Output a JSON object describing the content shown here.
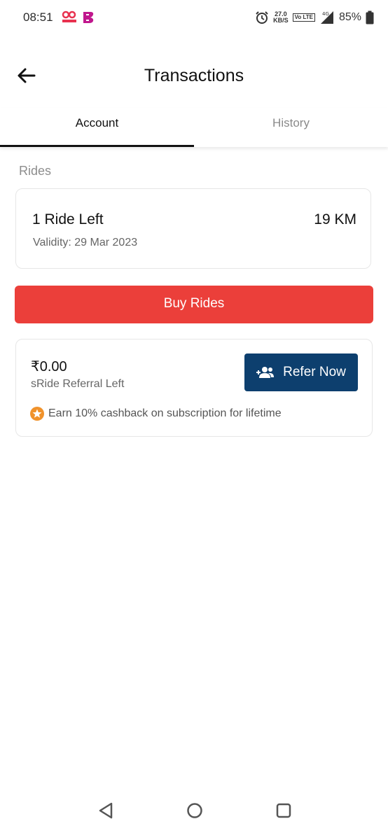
{
  "status_bar": {
    "time": "08:51",
    "speed_value": "27.0",
    "speed_unit": "KB/S",
    "volte": "Vo LTE",
    "network": "4G",
    "battery": "85%"
  },
  "header": {
    "title": "Transactions",
    "back_icon": "arrow-left-icon"
  },
  "tabs": [
    {
      "label": "Account",
      "active": true
    },
    {
      "label": "History",
      "active": false
    }
  ],
  "rides_section": {
    "label": "Rides",
    "rides_left": "1 Ride Left",
    "distance": "19 KM",
    "validity": "Validity: 29 Mar 2023"
  },
  "buy_button": {
    "label": "Buy Rides",
    "color": "#eb3f3a"
  },
  "referral": {
    "amount": "₹0.00",
    "label": "sRide Referral Left",
    "button_label": "Refer Now",
    "button_color": "#0d3f6e",
    "cashback_text": "Earn 10% cashback on subscription for lifetime",
    "cashback_icon": "star-badge-icon"
  },
  "nav_bar": {
    "back_icon": "triangle-back-icon",
    "home_icon": "circle-home-icon",
    "recents_icon": "square-recents-icon"
  }
}
